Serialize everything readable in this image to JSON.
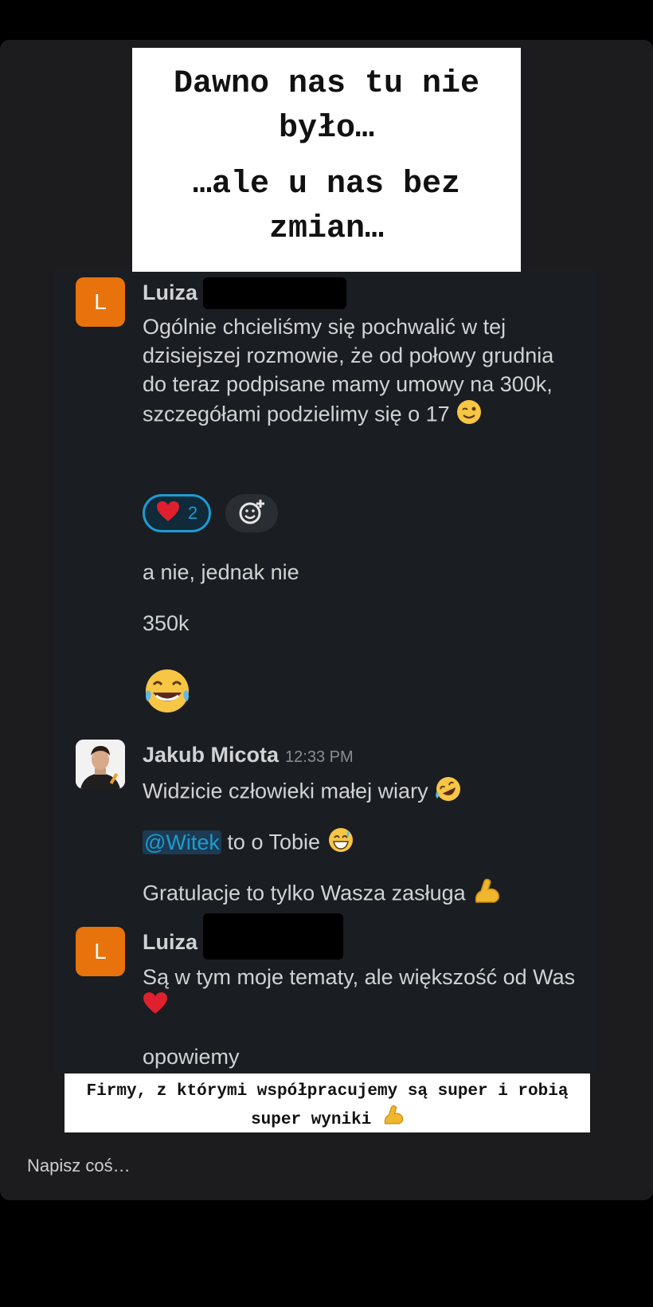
{
  "caption_top": {
    "line1": "Dawno nas tu nie było…",
    "line2": "…ale u nas bez zmian…"
  },
  "messages": {
    "luiza1": {
      "avatar_letter": "L",
      "name": "Luiza",
      "text": "Ogólnie chcieliśmy się pochwalić w tej dzisiejszej rozmowie, że od połowy grudnia do teraz podpisane mamy umowy na 300k, szczegółami podzielimy się o 17",
      "reaction_count": "2",
      "follow1": "a nie, jednak nie",
      "follow2": "350k"
    },
    "jakub": {
      "name": "Jakub Micota",
      "time": "12:33 PM",
      "text1": "Widzicie człowieki małej wiary",
      "mention": "@Witek",
      "text2": " to o Tobie",
      "text3": "Gratulacje to tylko Wasza zasługa"
    },
    "luiza2": {
      "avatar_letter": "L",
      "name": "Luiza",
      "text1": "Są w tym moje tematy, ale większość od Was",
      "text2": "opowiemy"
    }
  },
  "caption_bottom": {
    "text": "Firmy, z którymi współpracujemy są super i robią super wyniki"
  },
  "reply": {
    "placeholder": "Napisz coś…"
  },
  "colors": {
    "avatar": "#e8730c",
    "mention": "#1d9bd1",
    "chat_bg": "#1a1d21"
  },
  "icons": [
    "winking-face-emoji",
    "heart-emoji",
    "add-reaction-icon",
    "tears-of-joy-emoji",
    "rolling-laughing-emoji",
    "grinning-sweat-emoji",
    "flexed-biceps-emoji"
  ]
}
